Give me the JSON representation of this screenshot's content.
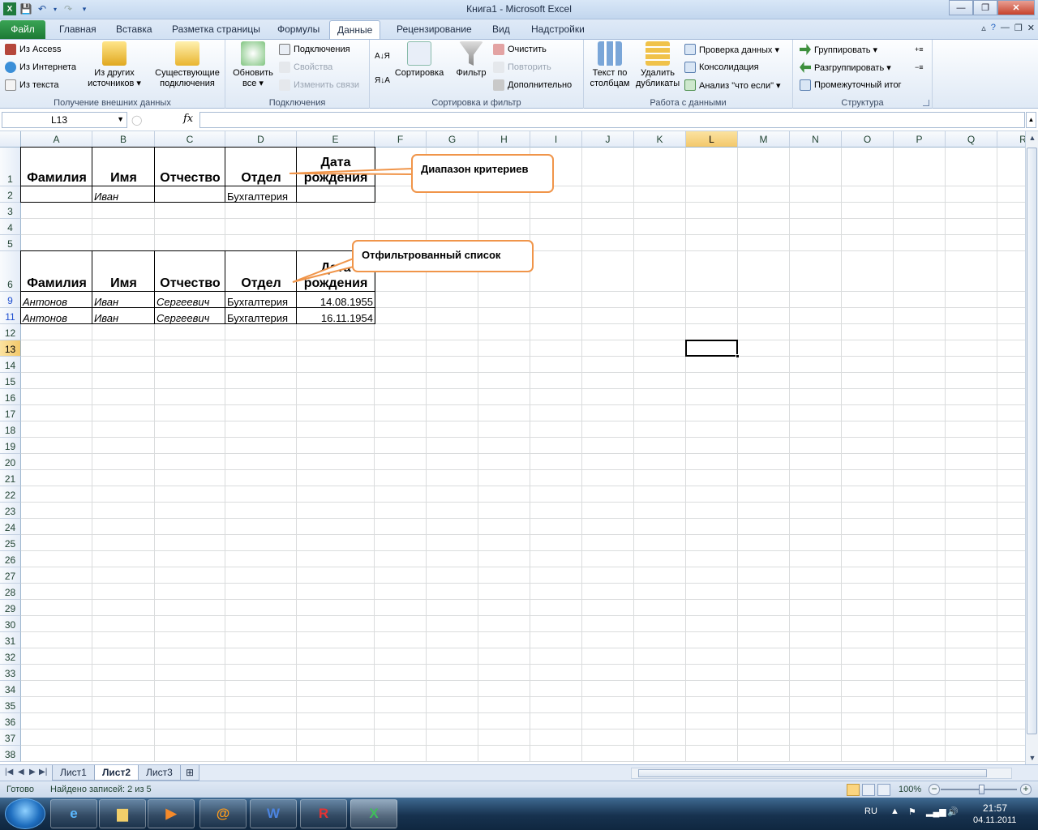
{
  "window": {
    "title": "Книга1  -  Microsoft Excel",
    "app_icon": "excel-icon",
    "controls": [
      "minimize-icon",
      "maximize-icon",
      "close-icon"
    ]
  },
  "qat": {
    "icons": [
      "save-icon",
      "undo-icon",
      "redo-icon",
      "customize-icon"
    ]
  },
  "ribbon_tabs": [
    {
      "label": "Файл"
    },
    {
      "label": "Главная"
    },
    {
      "label": "Вставка"
    },
    {
      "label": "Разметка страницы"
    },
    {
      "label": "Формулы"
    },
    {
      "label": "Данные"
    },
    {
      "label": "Рецензирование"
    },
    {
      "label": "Вид"
    },
    {
      "label": "Надстройки"
    }
  ],
  "active_tab": "Данные",
  "groups": {
    "external": {
      "label": "Получение внешних данных",
      "small": [
        "Из Access",
        "Из Интернета",
        "Из текста"
      ],
      "other_sources": "Из других\nисточников ▾",
      "existing": "Существующие\nподключения"
    },
    "connections": {
      "label": "Подключения",
      "refresh": "Обновить\nвсе ▾",
      "small": [
        "Подключения",
        "Свойства",
        "Изменить связи"
      ]
    },
    "sort": {
      "label": "Сортировка и фильтр",
      "sort": "Сортировка",
      "filter": "Фильтр",
      "small": [
        "Очистить",
        "Повторить",
        "Дополнительно"
      ]
    },
    "data_tools": {
      "label": "Работа с данными",
      "text_to_cols": "Текст по\nстолбцам",
      "remove_dup": "Удалить\nдубликаты",
      "small": [
        "Проверка данных ▾",
        "Консолидация",
        "Анализ \"что если\" ▾"
      ]
    },
    "outline": {
      "label": "Структура",
      "small": [
        "Группировать ▾",
        "Разгруппировать ▾",
        "Промежуточный итог"
      ]
    }
  },
  "formula_bar": {
    "name_box": "L13",
    "fx": "fx",
    "formula": ""
  },
  "columns": [
    "A",
    "B",
    "C",
    "D",
    "E",
    "F",
    "G",
    "H",
    "I",
    "J",
    "K",
    "L",
    "M",
    "N",
    "O",
    "P",
    "Q",
    "R"
  ],
  "rows": [
    "1",
    "2",
    "3",
    "4",
    "5",
    "6",
    "9",
    "11",
    "12",
    "13",
    "14",
    "15",
    "16",
    "17",
    "18",
    "19",
    "20",
    "21",
    "22",
    "23",
    "24",
    "25",
    "26",
    "27",
    "28",
    "29",
    "30",
    "31",
    "32",
    "33",
    "34",
    "35",
    "36",
    "37",
    "38"
  ],
  "selected_col": "L",
  "selected_row": "13",
  "criteria": {
    "headers": [
      "Фамилия",
      "Имя",
      "Отчество",
      "Отдел",
      "Дата\nрождения"
    ],
    "row2": {
      "B": "Иван",
      "D": "Бухгалтерия"
    }
  },
  "filtered": {
    "headers": [
      "Фамилия",
      "Имя",
      "Отчество",
      "Отдел",
      "Дата\nрождения"
    ],
    "records": [
      {
        "row": "9",
        "A": "Антонов",
        "B": "Иван",
        "C": "Сергеевич",
        "D": "Бухгалтерия",
        "E": "14.08.1955"
      },
      {
        "row": "11",
        "A": "Антонов",
        "B": "Иван",
        "C": "Сергеевич",
        "D": "Бухгалтерия",
        "E": "16.11.1954"
      }
    ]
  },
  "callouts": {
    "criteria": "Диапазон критериев",
    "filtered": "Отфильтрованный список"
  },
  "sheets": [
    {
      "label": "Лист1"
    },
    {
      "label": "Лист2",
      "active": true
    },
    {
      "label": "Лист3"
    }
  ],
  "status": {
    "ready": "Готово",
    "found": "Найдено записей: 2 из 5",
    "zoom": "100%"
  },
  "taskbar": {
    "apps": [
      "ie-icon",
      "explorer-icon",
      "media-player-icon",
      "mail-agent-icon",
      "word-icon",
      "finereader-icon",
      "excel-icon"
    ],
    "lang": "RU",
    "time": "21:57",
    "date": "04.11.2011"
  }
}
